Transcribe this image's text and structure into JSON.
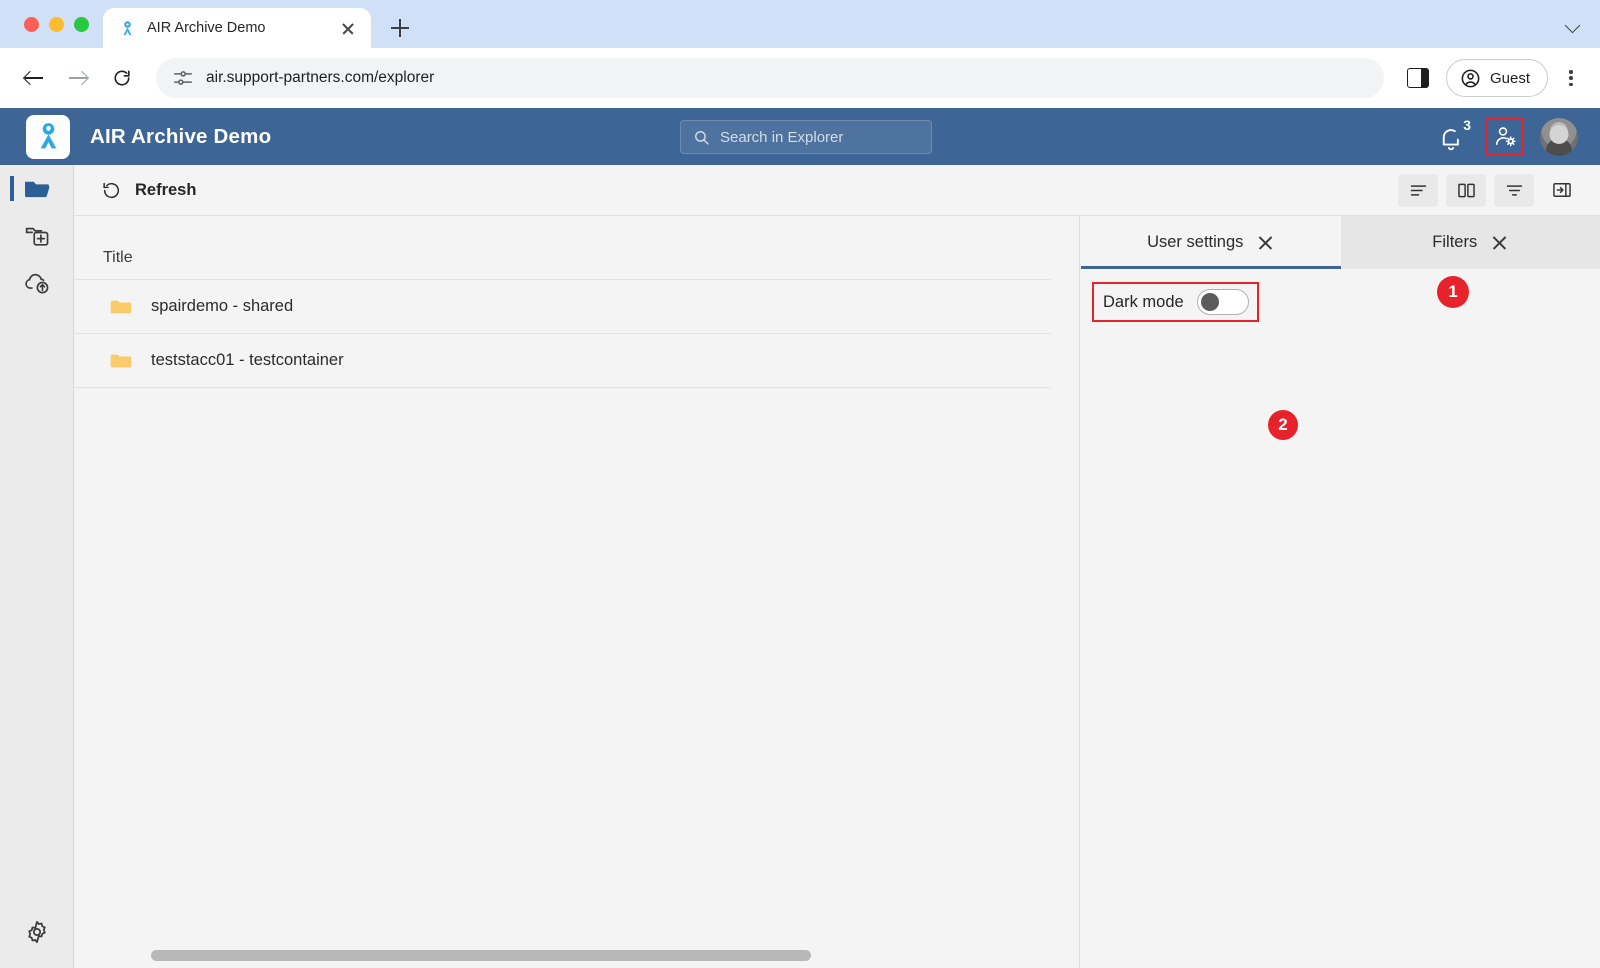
{
  "browser": {
    "tab": {
      "title": "AIR Archive Demo",
      "favicon": "air-logo-icon"
    },
    "url": "air.support-partners.com/explorer",
    "profile_label": "Guest",
    "icons": {
      "back": "back-arrow-icon",
      "forward": "forward-arrow-icon",
      "reload": "reload-icon",
      "site_info": "site-settings-icon",
      "new_tab": "plus-icon",
      "tab_list": "chevron-down-icon",
      "side_panel": "side-panel-icon",
      "menu": "kebab-menu-icon"
    }
  },
  "app": {
    "title": "AIR Archive Demo",
    "logo": "air-ribbon-logo-icon",
    "header_color": "#3d6595",
    "accent_color": "#3d6595",
    "badge_color": "#e8222b",
    "search": {
      "placeholder": "Search in Explorer",
      "value": "",
      "icon": "search-icon"
    },
    "notifications": {
      "count": "3",
      "icon": "bell-icon"
    },
    "user_settings_icon": "user-settings-icon",
    "avatar": "user-avatar"
  },
  "rail": {
    "items": [
      {
        "name": "explorer",
        "icon": "folder-open-icon",
        "active": true
      },
      {
        "name": "new-archive",
        "icon": "add-folder-icon",
        "active": false
      },
      {
        "name": "upload",
        "icon": "cloud-upload-icon",
        "active": false
      }
    ],
    "settings": {
      "name": "settings",
      "icon": "gear-icon"
    }
  },
  "toolbar": {
    "refresh_label": "Refresh",
    "refresh_icon": "refresh-icon",
    "actions": [
      {
        "name": "list-view",
        "icon": "list-view-icon"
      },
      {
        "name": "column-view",
        "icon": "column-view-icon"
      },
      {
        "name": "sort",
        "icon": "sort-icon"
      },
      {
        "name": "toggle-panel",
        "icon": "panel-toggle-icon"
      }
    ]
  },
  "filelist": {
    "columns": [
      "Title"
    ],
    "rows": [
      {
        "icon": "folder-icon",
        "title": "spairdemo - shared"
      },
      {
        "icon": "folder-icon",
        "title": "teststacc01 - testcontainer"
      }
    ]
  },
  "panel": {
    "tabs": [
      {
        "label": "User settings",
        "active": true,
        "close_icon": "close-icon"
      },
      {
        "label": "Filters",
        "active": false,
        "close_icon": "close-icon"
      }
    ],
    "dark_mode": {
      "label": "Dark mode",
      "enabled": false
    }
  },
  "annotations": [
    {
      "number": "1",
      "target": "user-settings-icon"
    },
    {
      "number": "2",
      "target": "dark-mode-toggle"
    }
  ]
}
